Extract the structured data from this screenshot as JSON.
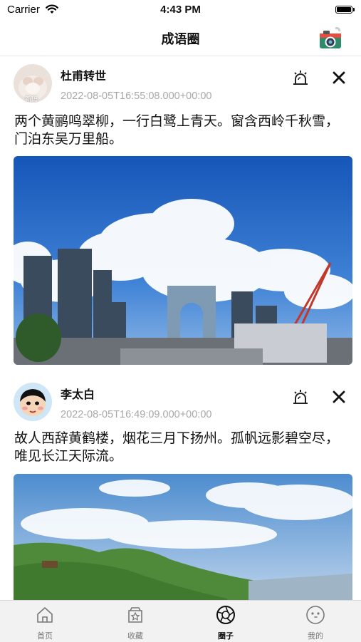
{
  "status_bar": {
    "carrier": "Carrier",
    "time": "4:43 PM"
  },
  "nav": {
    "title": "成语圈",
    "camera_icon": "camera-icon"
  },
  "posts": [
    {
      "author": "杜甫转世",
      "timestamp": "2022-08-05T16:55:08.000+00:00",
      "text": "两个黄鹂鸣翠柳，一行白鹭上青天。窗含西岭千秋雪，门泊东吴万里船。",
      "avatar_caption": "新玛",
      "image": "city-skyline-photo"
    },
    {
      "author": "李太白",
      "timestamp": "2022-08-05T16:49:09.000+00:00",
      "text": "故人西辞黄鹤楼，烟花三月下扬州。孤帆远影碧空尽，唯见长江天际流。",
      "image": "green-mountain-photo"
    }
  ],
  "tabs": [
    {
      "label": "首页",
      "icon": "home-icon",
      "active": false
    },
    {
      "label": "收藏",
      "icon": "favorites-icon",
      "active": false
    },
    {
      "label": "圈子",
      "icon": "aperture-icon",
      "active": true
    },
    {
      "label": "我的",
      "icon": "profile-face-icon",
      "active": false
    }
  ],
  "colors": {
    "timestamp": "#a8a8a8",
    "sky_blue": "#1e62c4",
    "tabbar_bg": "#f2f2f2"
  }
}
